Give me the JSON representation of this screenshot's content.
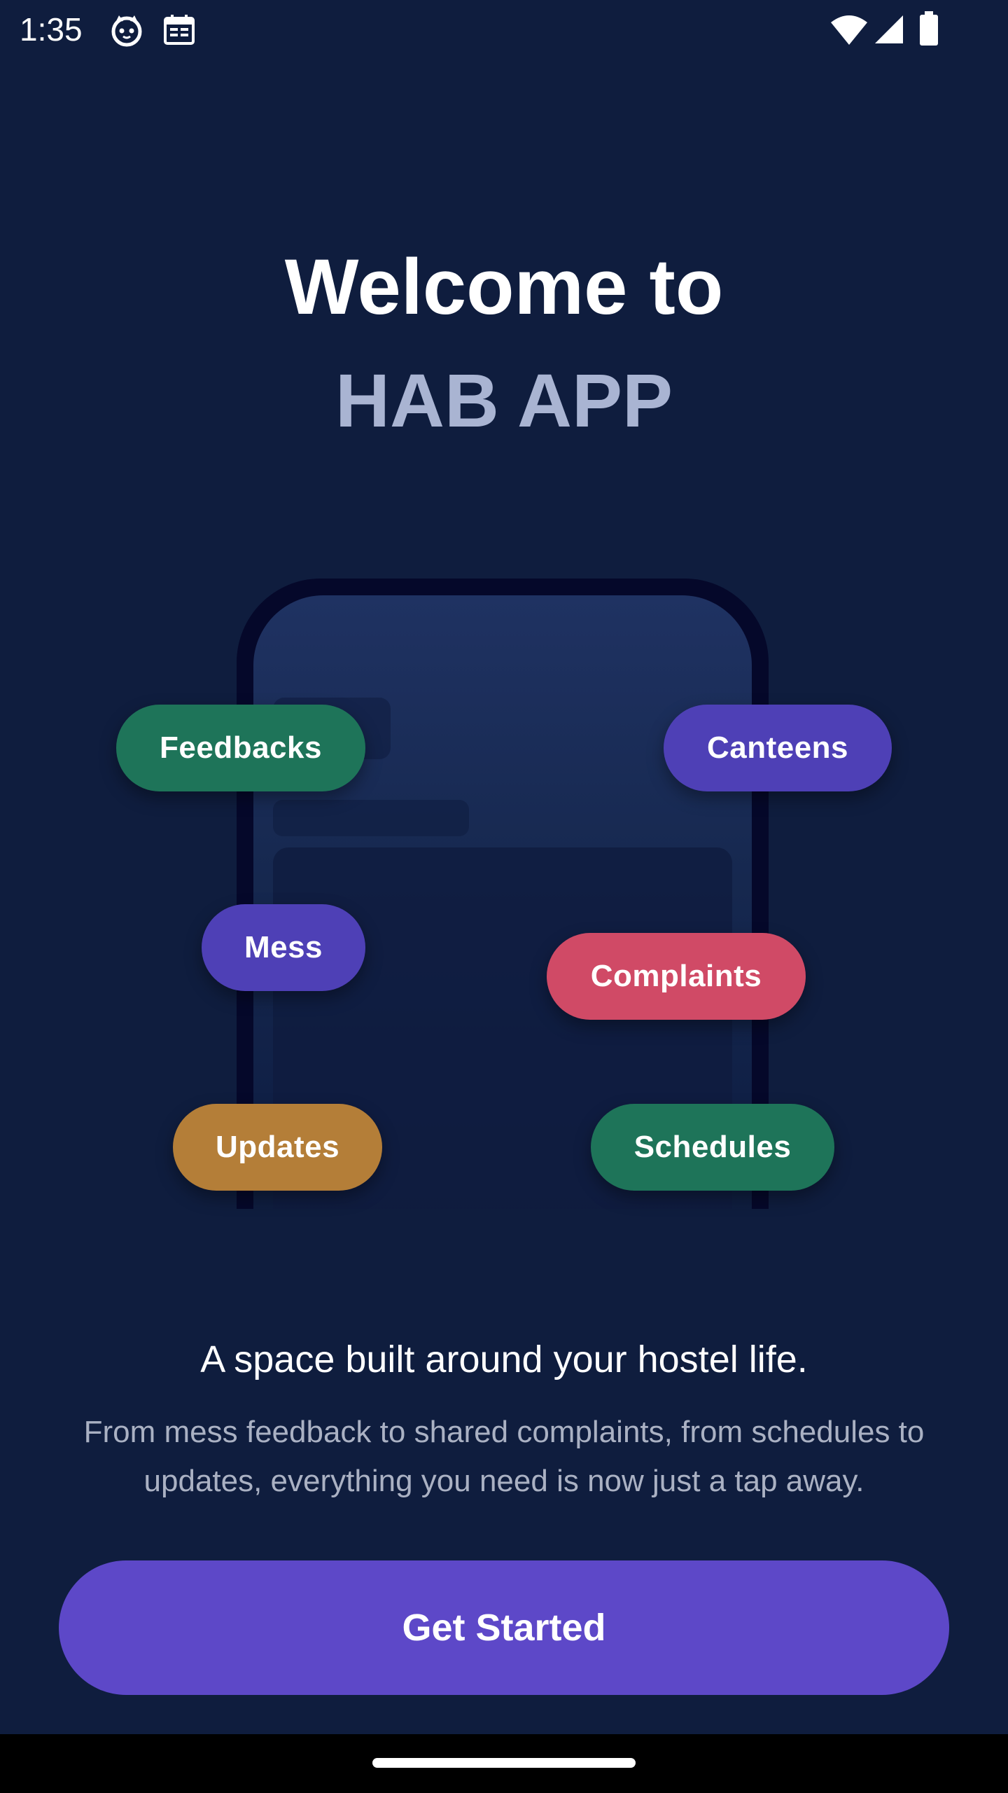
{
  "status_bar": {
    "time": "1:35",
    "icons": [
      "cat-face-icon",
      "calendar-icon",
      "wifi-icon",
      "cellular-signal-icon",
      "battery-icon"
    ]
  },
  "header": {
    "welcome": "Welcome to",
    "app_name": "HAB APP"
  },
  "features": [
    {
      "label": "Feedbacks",
      "color": "#1e7459"
    },
    {
      "label": "Canteens",
      "color": "#4e40b6"
    },
    {
      "label": "Mess",
      "color": "#4e40b6"
    },
    {
      "label": "Complaints",
      "color": "#d04a66"
    },
    {
      "label": "Updates",
      "color": "#b47e38"
    },
    {
      "label": "Schedules",
      "color": "#1e7459"
    }
  ],
  "tagline": "A space built around your hostel life.",
  "description": "From mess feedback to shared complaints, from schedules to updates, everything you need is now just a tap away.",
  "cta": {
    "label": "Get Started",
    "color": "#5d48c8"
  },
  "theme": {
    "background": "#0f1d3e",
    "app_name_color": "#a9b4d2"
  }
}
